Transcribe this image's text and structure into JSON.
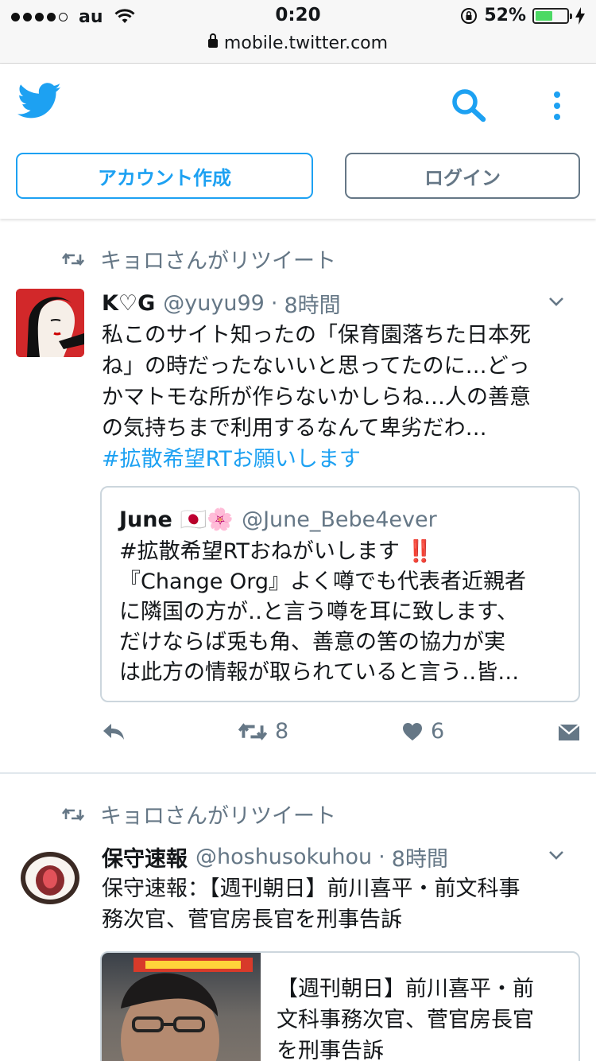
{
  "status_bar": {
    "carrier": "au",
    "time": "0:20",
    "battery": "52%",
    "battery_level": 0.52,
    "url": "mobile.twitter.com"
  },
  "header": {
    "signup_label": "アカウント作成",
    "login_label": "ログイン"
  },
  "colors": {
    "accent": "#1da1f2",
    "muted": "#657786",
    "divider": "#e1e8ed"
  },
  "timeline": [
    {
      "retweet_label": "キョロさんがリツイート",
      "name": "K♡G",
      "handle": "@yuyu99",
      "time": "8時間",
      "text_lines": [
        "私このサイト知ったの「保育園落ちた日本死",
        "ね」の時だったないいと思ってたのに…どっ",
        "かマトモな所が作らないかしらね…人の善意",
        "の気持ちまで利用するなんて卑劣だわ…"
      ],
      "hashtag": "#拡散希望RTお願いします",
      "quote": {
        "name": "June",
        "name_emoji": "🇯🇵🌸",
        "handle": "@June_Bebe4ever",
        "text_line1": "#拡散希望RTおねがいします",
        "text_line1_emoji": "‼️",
        "text_lines": [
          "『Change Org』よく噂でも代表者近親者",
          "に隣国の方が‥と言う噂を耳に致します、",
          "だけならば兎も角、善意の筈の協力が実",
          "は此方の情報が取られていると言う‥皆…"
        ]
      },
      "retweets": "8",
      "likes": "6"
    },
    {
      "retweet_label": "キョロさんがリツイート",
      "name": "保守速報",
      "handle": "@hoshusokuhou",
      "time": "8時間",
      "text_lines": [
        "保守速報：【週刊朝日】前川喜平・前文科事",
        "務次官、菅官房長官を刑事告訴"
      ],
      "card_text_lines": [
        "【週刊朝日】前川喜平・前",
        "文科事務次官、菅官房長官",
        "を刑事告訴"
      ]
    }
  ]
}
